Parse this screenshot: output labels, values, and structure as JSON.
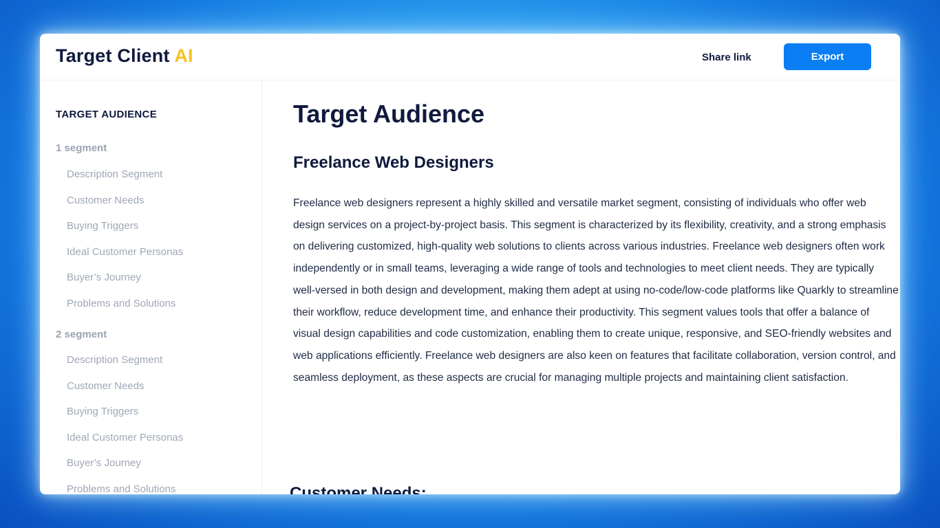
{
  "header": {
    "brand_main": "Target Client",
    "brand_accent": "AI",
    "share_label": "Share link",
    "export_label": "Export"
  },
  "sidebar": {
    "title": "TARGET AUDIENCE",
    "segments": [
      {
        "label": "1 segment",
        "items": [
          "Description Segment",
          "Customer Needs",
          "Buying Triggers",
          "Ideal Customer Personas",
          "Buyer’s Journey",
          "Problems and Solutions"
        ]
      },
      {
        "label": "2 segment",
        "items": [
          "Description Segment",
          "Customer Needs",
          "Buying Triggers",
          "Ideal Customer Personas",
          "Buyer’s Journey",
          "Problems and Solutions"
        ]
      }
    ]
  },
  "main": {
    "title": "Target Audience",
    "section_title": "Freelance Web Designers",
    "paragraph": "Freelance web designers represent a highly skilled and versatile market segment, consisting of individuals who offer web design services on a project-by-project basis. This segment is characterized by its flexibility, creativity, and a strong emphasis on delivering customized, high-quality web solutions to clients across various industries. Freelance web designers often work independently or in small teams, leveraging a wide range of tools and technologies to meet client needs. They are typically well-versed in both design and development, making them adept at using no-code/low-code platforms like Quarkly to streamline their workflow, reduce development time, and enhance their productivity. This segment values tools that offer a balance of visual design capabilities and code customization, enabling them to create unique, responsive, and SEO-friendly websites and web applications efficiently. Freelance web designers are also keen on features that facilitate collaboration, version control, and seamless deployment, as these aspects are crucial for managing multiple projects and maintaining client satisfaction.",
    "subsection_title": "Customer Needs:"
  },
  "colors": {
    "accent": "#0a7ef2",
    "brand_accent": "#f6c31d",
    "text_dark": "#0f1a3d",
    "muted": "#9ea7b6"
  }
}
